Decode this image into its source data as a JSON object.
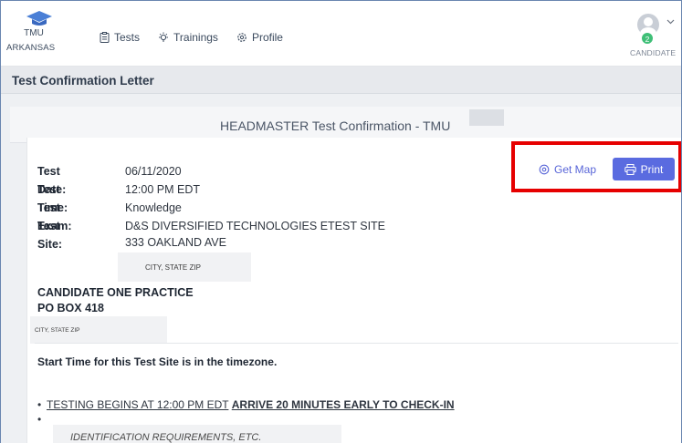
{
  "brand": {
    "name": "TMU",
    "state": "ARKANSAS"
  },
  "nav": {
    "items": [
      {
        "label": "Tests",
        "icon": "clipboard-icon"
      },
      {
        "label": "Trainings",
        "icon": "lightbulb-icon"
      },
      {
        "label": "Profile",
        "icon": "gear-icon"
      }
    ]
  },
  "user": {
    "badge_count": "2",
    "role": "CANDIDATE"
  },
  "page": {
    "title": "Test Confirmation Letter",
    "card_title": "HEADMASTER Test Confirmation - TMU"
  },
  "test": {
    "date_label": "Test Date:",
    "date": "06/11/2020",
    "time_label": "Test Time:",
    "time": "12:00 PM EDT",
    "exam_label": "Test Exam:",
    "exam": "Knowledge",
    "site_label": "Test Site:",
    "site_name": "D&S DIVERSIFIED TECHNOLOGIES ETEST SITE",
    "site_address": "333 OAKLAND AVE",
    "site_city": "CITY, STATE ZIP"
  },
  "candidate": {
    "name": "CANDIDATE ONE PRACTICE",
    "address": "PO BOX 418",
    "city": "CITY, STATE ZIP"
  },
  "start_time_note": "Start Time for this Test Site is in the timezone.",
  "instructions": {
    "line1_prefix": "TESTING BEGINS AT 12:00 PM EDT",
    "line1_bold": "ARRIVE 20 MINUTES EARLY TO CHECK-IN",
    "line2": "IDENTIFICATION REQUIREMENTS, ETC."
  },
  "actions": {
    "map_label": "Get Map",
    "print_label": "Print"
  },
  "colors": {
    "accent": "#5a6be0",
    "highlight": "#e60000",
    "badge": "#3fbf77"
  }
}
